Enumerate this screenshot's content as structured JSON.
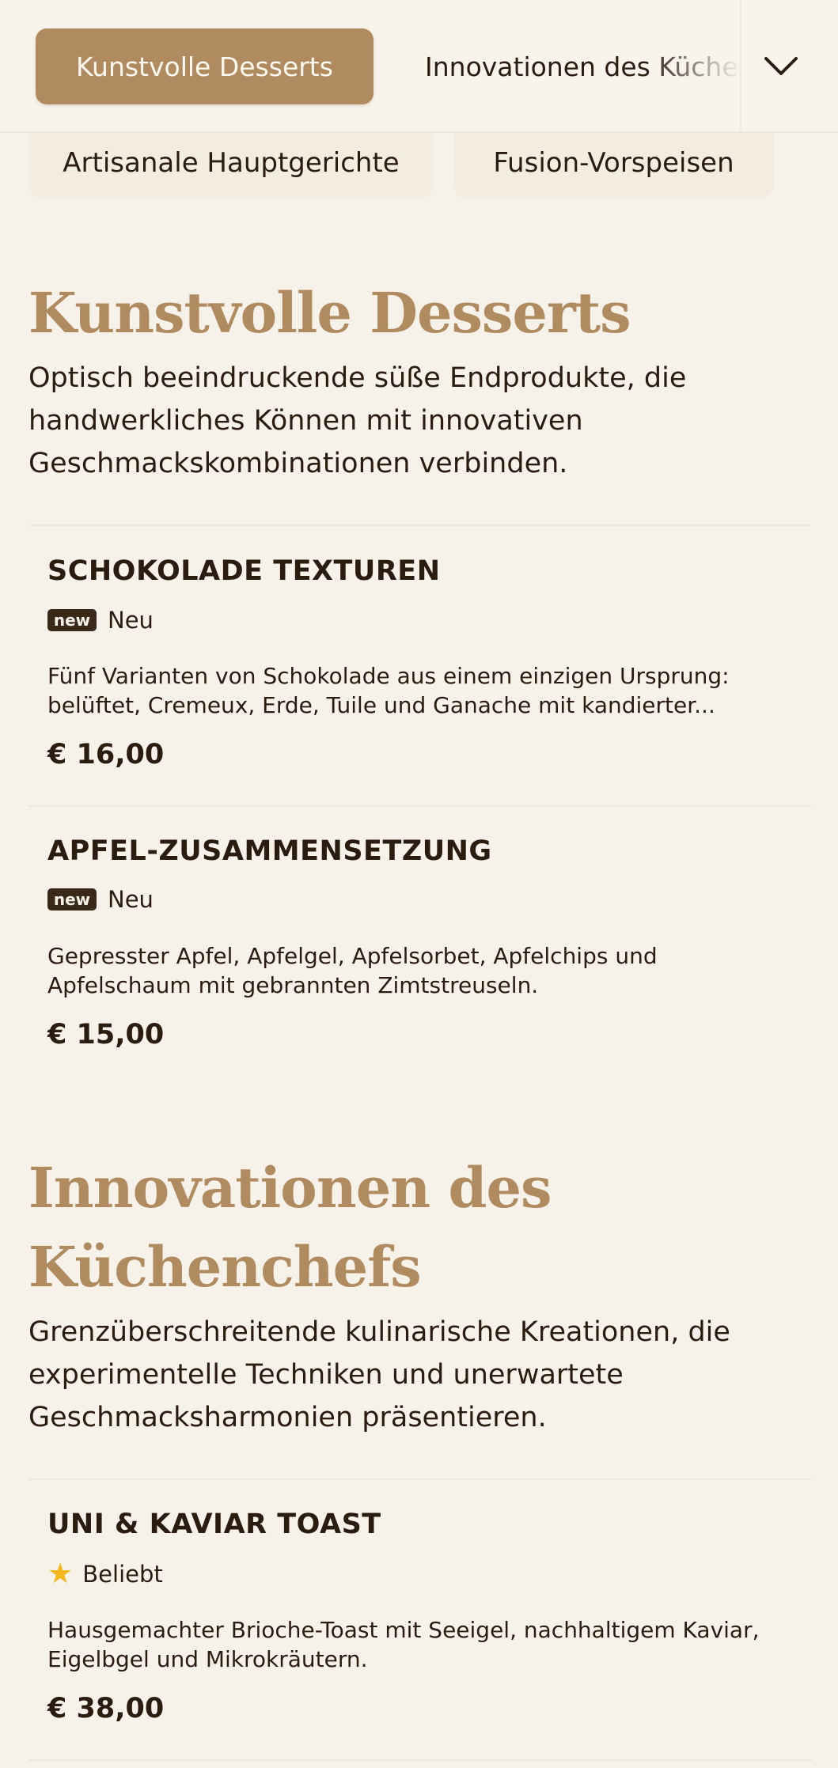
{
  "nav": {
    "active_tab": "Kunstvolle Desserts",
    "next_tab": "Innovationen des Küchenchefs",
    "expand_icon": "chevron-down-icon"
  },
  "subnav": {
    "tabs": [
      "Artisanale Hauptgerichte",
      "Fusion-Vorspeisen"
    ]
  },
  "sections": [
    {
      "title": "Kunstvolle Desserts",
      "description": "Optisch beeindruckende süße Endprodukte, die handwerkliches Können mit innovativen Geschmackskombinationen verbinden.",
      "items": [
        {
          "name": "SCHOKOLADE TEXTUREN",
          "badge_tag": "new",
          "badge_label": "Neu",
          "description": "Fünf Varianten von Schokolade aus einem einzigen Ursprung: belüftet, Cremeux, Erde, Tuile und Ganache mit kandierter...",
          "price": "€ 16,00"
        },
        {
          "name": "APFEL-ZUSAMMENSETZUNG",
          "badge_tag": "new",
          "badge_label": "Neu",
          "description": "Gepresster Apfel, Apfelgel, Apfelsorbet, Apfelchips und Apfelschaum mit gebrannten Zimtstreuseln.",
          "price": "€ 15,00"
        }
      ]
    },
    {
      "title_line1": "Innovationen des",
      "title_line2": "Küchenchefs",
      "description": "Grenzüberschreitende kulinarische Kreationen, die experimentelle Techniken und unerwartete Geschmacksharmonien präsentieren.",
      "items": [
        {
          "name": "UNI & KAVIAR TOAST",
          "badge_icon": "star-icon",
          "badge_label": "Beliebt",
          "description": "Hausgemachter Brioche-Toast mit Seeigel, nachhaltigem Kaviar, Eigelbgel und Mikrokräutern.",
          "price": "€ 38,00"
        }
      ]
    }
  ],
  "colors": {
    "accent": "#b08b60",
    "background": "#f7f2e9",
    "text": "#2a1c0f",
    "star": "#f2b81d"
  }
}
